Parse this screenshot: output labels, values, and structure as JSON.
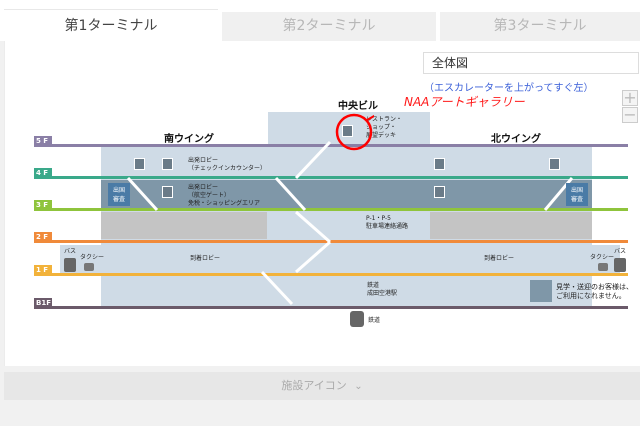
{
  "tabs": [
    {
      "label": "第1ターミナル",
      "active": true
    },
    {
      "label": "第2ターミナル",
      "active": false
    },
    {
      "label": "第3ターミナル",
      "active": false
    }
  ],
  "view_select": {
    "value": "全体図"
  },
  "zoom": {
    "in": "+",
    "out": "−"
  },
  "annotations": {
    "escalator_note": "（エスカレーターを上がってすぐ左）",
    "gallery": "NAAアートギャラリー"
  },
  "map": {
    "center_building": "中央ビル",
    "south_wing": "南ウイング",
    "north_wing": "北ウイング",
    "floors": [
      "5 F",
      "4 F",
      "3 F",
      "2 F",
      "1 F",
      "B1F"
    ],
    "labels": {
      "restaurant": [
        "レストラン・",
        "ショップ・",
        "展望デッキ"
      ],
      "departure_lobby_checkin": [
        "出発ロビー",
        "（チェックインカウンター）"
      ],
      "departure_lobby_security": [
        "出発ロビー",
        "（航空ゲート）",
        "免税・ショッピングエリア"
      ],
      "parking_link": [
        "P-1・P-5",
        "駐車場連絡通路"
      ],
      "arrival_lobby_south": "到着ロビー",
      "arrival_lobby_north": "到着ロビー",
      "railway_station": [
        "鉄道",
        "成田空港駅"
      ],
      "immigration_s": [
        "出国",
        "審査"
      ],
      "immigration_n": [
        "出国",
        "審査"
      ],
      "bus_left": "バス",
      "taxi_left": "タクシー",
      "bus_right": "バス",
      "taxi_right": "タクシー",
      "railway_icon_label": "鉄道",
      "legend": [
        "見学・送迎のお客様は、",
        "ご利用になれません。"
      ]
    },
    "colors": {
      "f5": "#8a7fa6",
      "f4": "#3aa98a",
      "f3": "#8fc43c",
      "f2": "#f08a3a",
      "f1": "#f2b23a",
      "b1": "#6b5a6a",
      "block_light": "#cfdbe6",
      "block_dark": "#7f97a8",
      "block_gray": "#c4c4c4"
    }
  },
  "facility_icons": {
    "label": "施設アイコン"
  }
}
